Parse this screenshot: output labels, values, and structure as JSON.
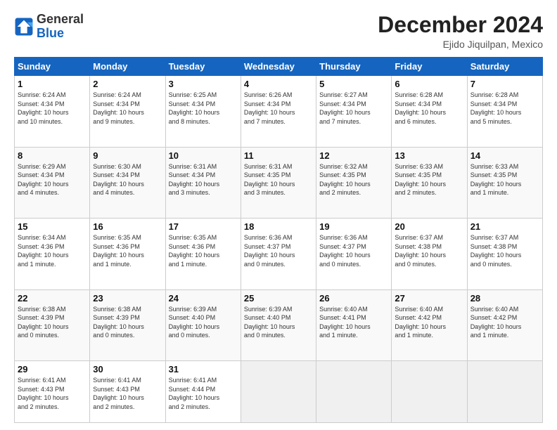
{
  "header": {
    "logo_line1": "General",
    "logo_line2": "Blue",
    "month_year": "December 2024",
    "location": "Ejido Jiquilpan, Mexico"
  },
  "days_of_week": [
    "Sunday",
    "Monday",
    "Tuesday",
    "Wednesday",
    "Thursday",
    "Friday",
    "Saturday"
  ],
  "weeks": [
    [
      {
        "day": "1",
        "info": "Sunrise: 6:24 AM\nSunset: 4:34 PM\nDaylight: 10 hours\nand 10 minutes."
      },
      {
        "day": "2",
        "info": "Sunrise: 6:24 AM\nSunset: 4:34 PM\nDaylight: 10 hours\nand 9 minutes."
      },
      {
        "day": "3",
        "info": "Sunrise: 6:25 AM\nSunset: 4:34 PM\nDaylight: 10 hours\nand 8 minutes."
      },
      {
        "day": "4",
        "info": "Sunrise: 6:26 AM\nSunset: 4:34 PM\nDaylight: 10 hours\nand 7 minutes."
      },
      {
        "day": "5",
        "info": "Sunrise: 6:27 AM\nSunset: 4:34 PM\nDaylight: 10 hours\nand 7 minutes."
      },
      {
        "day": "6",
        "info": "Sunrise: 6:28 AM\nSunset: 4:34 PM\nDaylight: 10 hours\nand 6 minutes."
      },
      {
        "day": "7",
        "info": "Sunrise: 6:28 AM\nSunset: 4:34 PM\nDaylight: 10 hours\nand 5 minutes."
      }
    ],
    [
      {
        "day": "8",
        "info": "Sunrise: 6:29 AM\nSunset: 4:34 PM\nDaylight: 10 hours\nand 4 minutes."
      },
      {
        "day": "9",
        "info": "Sunrise: 6:30 AM\nSunset: 4:34 PM\nDaylight: 10 hours\nand 4 minutes."
      },
      {
        "day": "10",
        "info": "Sunrise: 6:31 AM\nSunset: 4:34 PM\nDaylight: 10 hours\nand 3 minutes."
      },
      {
        "day": "11",
        "info": "Sunrise: 6:31 AM\nSunset: 4:35 PM\nDaylight: 10 hours\nand 3 minutes."
      },
      {
        "day": "12",
        "info": "Sunrise: 6:32 AM\nSunset: 4:35 PM\nDaylight: 10 hours\nand 2 minutes."
      },
      {
        "day": "13",
        "info": "Sunrise: 6:33 AM\nSunset: 4:35 PM\nDaylight: 10 hours\nand 2 minutes."
      },
      {
        "day": "14",
        "info": "Sunrise: 6:33 AM\nSunset: 4:35 PM\nDaylight: 10 hours\nand 1 minute."
      }
    ],
    [
      {
        "day": "15",
        "info": "Sunrise: 6:34 AM\nSunset: 4:36 PM\nDaylight: 10 hours\nand 1 minute."
      },
      {
        "day": "16",
        "info": "Sunrise: 6:35 AM\nSunset: 4:36 PM\nDaylight: 10 hours\nand 1 minute."
      },
      {
        "day": "17",
        "info": "Sunrise: 6:35 AM\nSunset: 4:36 PM\nDaylight: 10 hours\nand 1 minute."
      },
      {
        "day": "18",
        "info": "Sunrise: 6:36 AM\nSunset: 4:37 PM\nDaylight: 10 hours\nand 0 minutes."
      },
      {
        "day": "19",
        "info": "Sunrise: 6:36 AM\nSunset: 4:37 PM\nDaylight: 10 hours\nand 0 minutes."
      },
      {
        "day": "20",
        "info": "Sunrise: 6:37 AM\nSunset: 4:38 PM\nDaylight: 10 hours\nand 0 minutes."
      },
      {
        "day": "21",
        "info": "Sunrise: 6:37 AM\nSunset: 4:38 PM\nDaylight: 10 hours\nand 0 minutes."
      }
    ],
    [
      {
        "day": "22",
        "info": "Sunrise: 6:38 AM\nSunset: 4:39 PM\nDaylight: 10 hours\nand 0 minutes."
      },
      {
        "day": "23",
        "info": "Sunrise: 6:38 AM\nSunset: 4:39 PM\nDaylight: 10 hours\nand 0 minutes."
      },
      {
        "day": "24",
        "info": "Sunrise: 6:39 AM\nSunset: 4:40 PM\nDaylight: 10 hours\nand 0 minutes."
      },
      {
        "day": "25",
        "info": "Sunrise: 6:39 AM\nSunset: 4:40 PM\nDaylight: 10 hours\nand 0 minutes."
      },
      {
        "day": "26",
        "info": "Sunrise: 6:40 AM\nSunset: 4:41 PM\nDaylight: 10 hours\nand 1 minute."
      },
      {
        "day": "27",
        "info": "Sunrise: 6:40 AM\nSunset: 4:42 PM\nDaylight: 10 hours\nand 1 minute."
      },
      {
        "day": "28",
        "info": "Sunrise: 6:40 AM\nSunset: 4:42 PM\nDaylight: 10 hours\nand 1 minute."
      }
    ],
    [
      {
        "day": "29",
        "info": "Sunrise: 6:41 AM\nSunset: 4:43 PM\nDaylight: 10 hours\nand 2 minutes."
      },
      {
        "day": "30",
        "info": "Sunrise: 6:41 AM\nSunset: 4:43 PM\nDaylight: 10 hours\nand 2 minutes."
      },
      {
        "day": "31",
        "info": "Sunrise: 6:41 AM\nSunset: 4:44 PM\nDaylight: 10 hours\nand 2 minutes."
      },
      null,
      null,
      null,
      null
    ]
  ]
}
